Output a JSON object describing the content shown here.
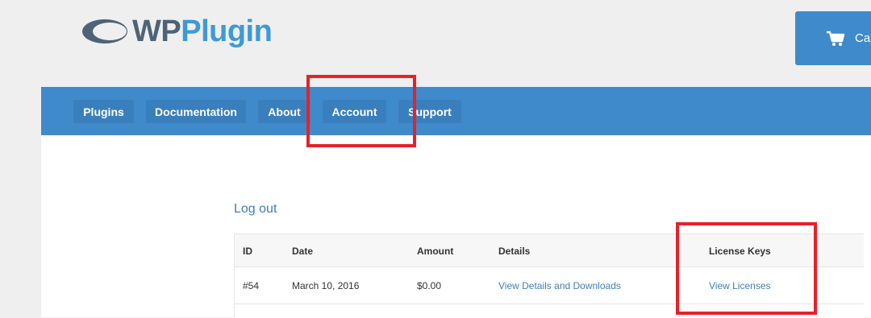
{
  "logo": {
    "wp": "WP",
    "plugin": "Plugin",
    "icon": "ring-logo-icon"
  },
  "cart": {
    "label": "Ca",
    "icon": "cart-icon"
  },
  "nav": {
    "items": [
      {
        "label": "Plugins"
      },
      {
        "label": "Documentation"
      },
      {
        "label": "About"
      },
      {
        "label": "Account"
      },
      {
        "label": "Support"
      }
    ]
  },
  "account": {
    "logout_label": "Log out",
    "table": {
      "headers": [
        "ID",
        "Date",
        "Amount",
        "Details",
        "License Keys"
      ],
      "rows": [
        [
          "#54",
          "March 10, 2016",
          "$0.00",
          "View Details and Downloads",
          "View Licenses"
        ]
      ]
    }
  },
  "colors": {
    "nav": "#3f8acb",
    "link": "#3f7fb8",
    "highlight": "#e8202a",
    "logo_wp": "#4d6377",
    "logo_plugin": "#3d9ad6"
  }
}
